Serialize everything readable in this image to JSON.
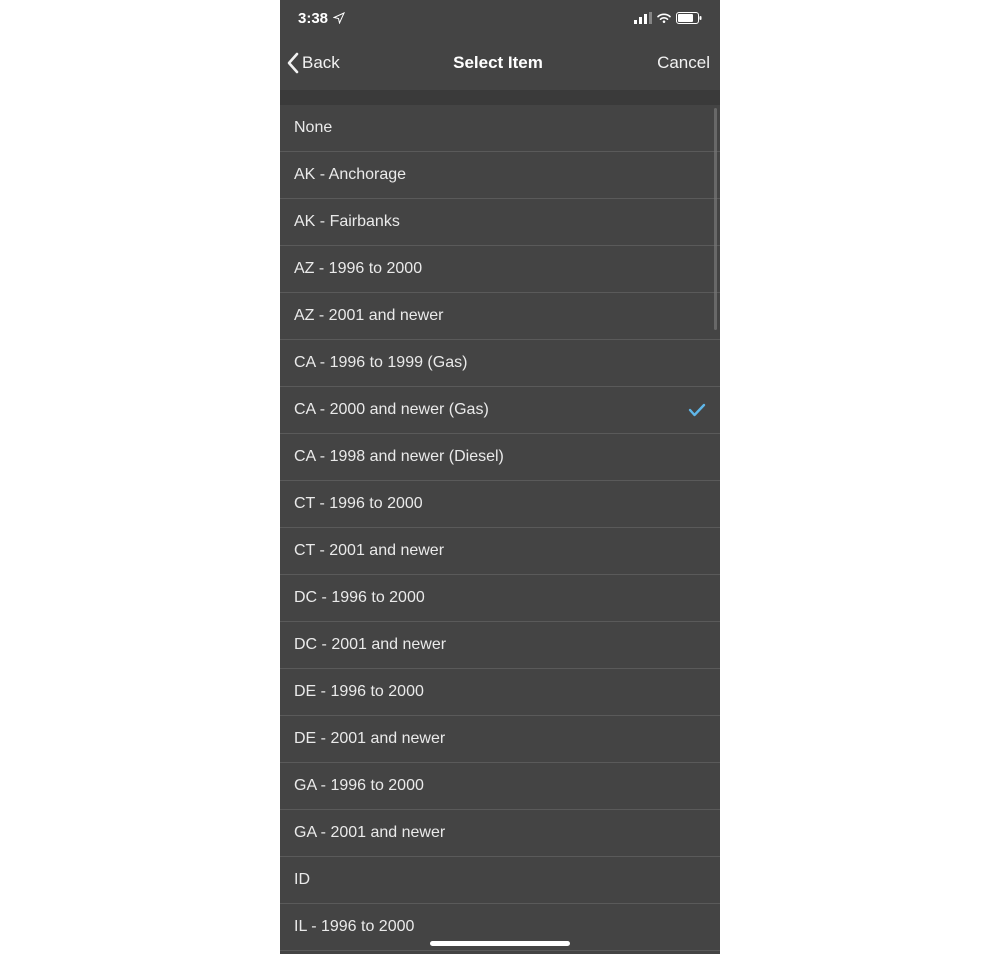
{
  "status": {
    "time": "3:38"
  },
  "nav": {
    "back": "Back",
    "title": "Select Item",
    "cancel": "Cancel"
  },
  "list": {
    "items": [
      {
        "label": "None",
        "selected": false
      },
      {
        "label": "AK - Anchorage",
        "selected": false
      },
      {
        "label": "AK - Fairbanks",
        "selected": false
      },
      {
        "label": "AZ - 1996 to 2000",
        "selected": false
      },
      {
        "label": "AZ - 2001 and newer",
        "selected": false
      },
      {
        "label": "CA - 1996 to 1999 (Gas)",
        "selected": false
      },
      {
        "label": "CA - 2000 and newer (Gas)",
        "selected": true
      },
      {
        "label": "CA - 1998 and newer (Diesel)",
        "selected": false
      },
      {
        "label": "CT - 1996 to 2000",
        "selected": false
      },
      {
        "label": "CT - 2001 and newer",
        "selected": false
      },
      {
        "label": "DC - 1996 to 2000",
        "selected": false
      },
      {
        "label": "DC - 2001 and newer",
        "selected": false
      },
      {
        "label": "DE - 1996 to 2000",
        "selected": false
      },
      {
        "label": "DE - 2001 and newer",
        "selected": false
      },
      {
        "label": "GA - 1996 to 2000",
        "selected": false
      },
      {
        "label": "GA - 2001 and newer",
        "selected": false
      },
      {
        "label": "ID",
        "selected": false
      },
      {
        "label": "IL - 1996 to 2000",
        "selected": false
      }
    ]
  }
}
